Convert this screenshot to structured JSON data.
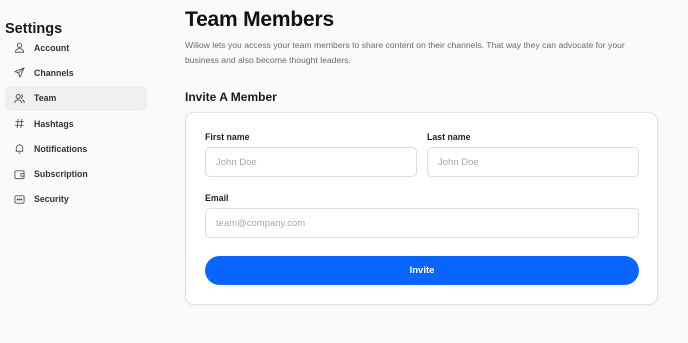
{
  "sidebar": {
    "title": "Settings",
    "items": [
      {
        "label": "Account",
        "icon": "user-icon",
        "active": false
      },
      {
        "label": "Channels",
        "icon": "send-icon",
        "active": false
      },
      {
        "label": "Team",
        "icon": "users-icon",
        "active": true
      },
      {
        "label": "Hashtags",
        "icon": "hashtag-icon",
        "active": false
      },
      {
        "label": "Notifications",
        "icon": "bell-icon",
        "active": false
      },
      {
        "label": "Subscription",
        "icon": "wallet-icon",
        "active": false
      },
      {
        "label": "Security",
        "icon": "password-icon",
        "active": false
      }
    ]
  },
  "main": {
    "title": "Team Members",
    "description": "Willow lets you access your team members to share content on their channels. That way they can advocate for your business and also become thought leaders.",
    "section_title": "Invite A Member",
    "form": {
      "first_name_label": "First name",
      "first_name_placeholder": "John Doe",
      "last_name_label": "Last name",
      "last_name_placeholder": "John Doe",
      "email_label": "Email",
      "email_placeholder": "team@company.com",
      "invite_label": "Invite"
    }
  },
  "colors": {
    "accent": "#0866ff",
    "active_nav_bg": "#efefef",
    "page_bg": "#fafafa"
  }
}
